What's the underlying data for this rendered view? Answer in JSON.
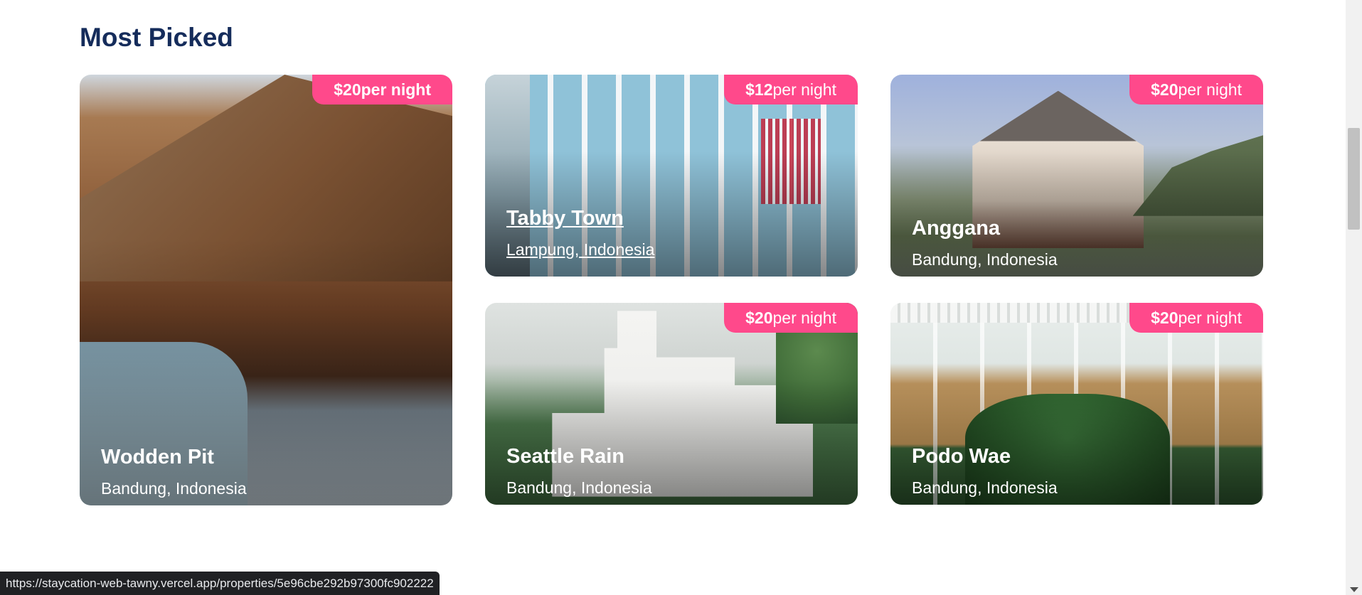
{
  "section": {
    "title": "Most Picked"
  },
  "cards": [
    {
      "name": "Wodden Pit",
      "location": "Bandung, Indonesia",
      "price": "$20",
      "unit": "per night"
    },
    {
      "name": "Tabby Town",
      "location": "Lampung, Indonesia",
      "price": "$12",
      "unit": "per night"
    },
    {
      "name": "Anggana",
      "location": "Bandung, Indonesia",
      "price": "$20",
      "unit": "per night"
    },
    {
      "name": "Seattle Rain",
      "location": "Bandung, Indonesia",
      "price": "$20",
      "unit": "per night"
    },
    {
      "name": "Podo Wae",
      "location": "Bandung, Indonesia",
      "price": "$20",
      "unit": "per night"
    }
  ],
  "status_bar": {
    "url": "https://staycation-web-tawny.vercel.app/properties/5e96cbe292b97300fc902222"
  },
  "colors": {
    "title": "#152c5b",
    "badge": "#ff498b"
  }
}
